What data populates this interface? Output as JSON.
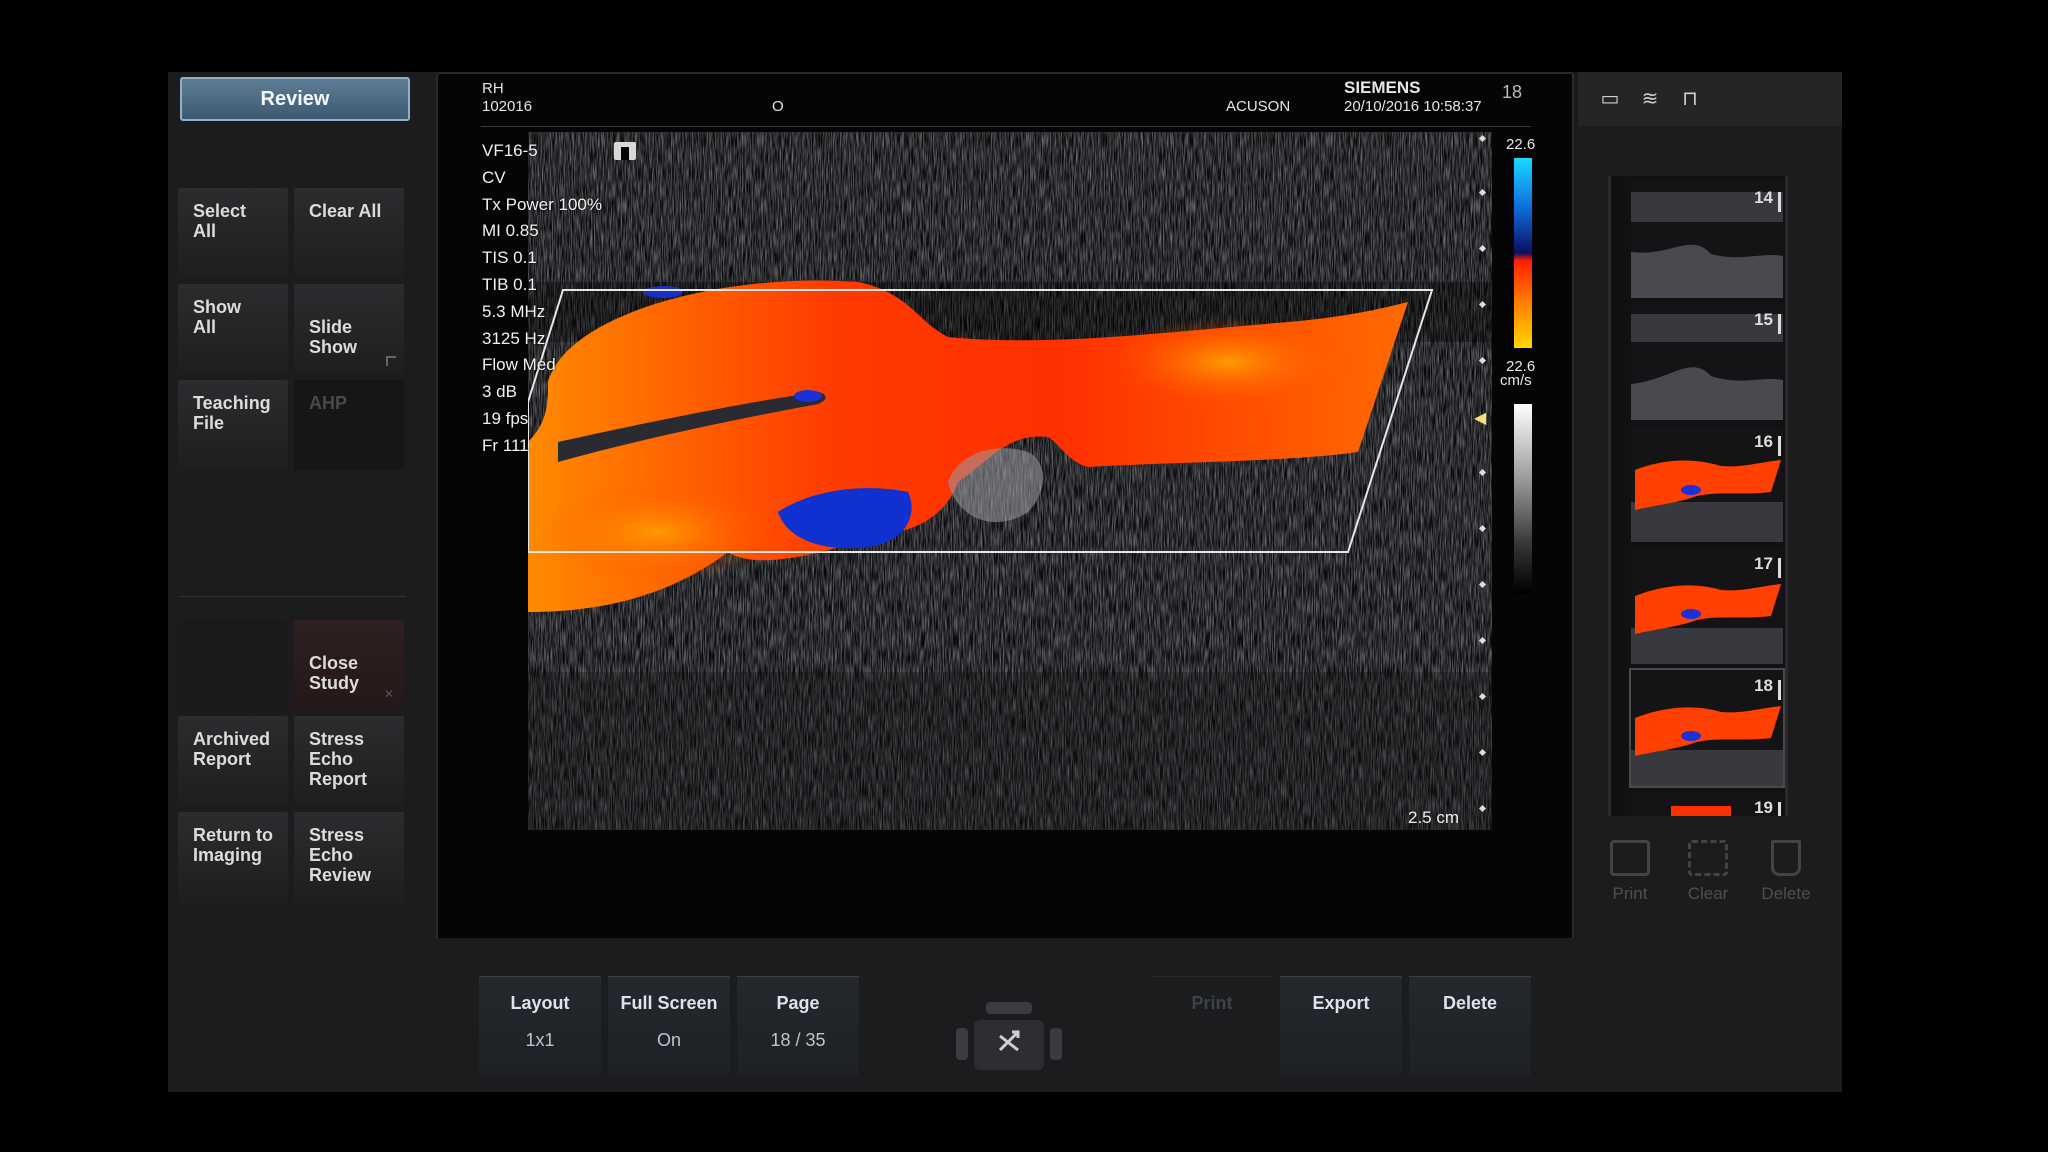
{
  "left_panel": {
    "review_tab": "Review",
    "buttons": {
      "select_all": "Select All",
      "clear_all": "Clear All",
      "show_all": "Show\nAll",
      "slide_show": "Slide\nShow",
      "teaching_file": "Teaching\nFile",
      "ahp": "AHP",
      "close_study": "Close\nStudy",
      "archived_report": "Archived\nReport",
      "stress_echo_report": "Stress\nEcho\nReport",
      "return_to_imaging": "Return to\nImaging",
      "stress_echo_review": "Stress\nEcho\nReview"
    }
  },
  "image_header": {
    "patient_line1": "RH",
    "patient_line2": "102016",
    "center_marker": "O",
    "system": "ACUSON",
    "brand": "SIEMENS",
    "datetime": "20/10/2016 10:58:37",
    "frame_number": "18"
  },
  "params": [
    "VF16-5",
    "CV",
    "Tx Power 100%",
    "MI 0.85",
    "TIS 0.1",
    "TIB 0.1",
    "5.3 MHz",
    "3125 Hz",
    "Flow Med",
    "3 dB",
    "19 fps",
    "Fr 111"
  ],
  "color_scale": {
    "top_value": "22.6",
    "bottom_value": "22.6",
    "unit": "cm/s"
  },
  "depth_label": "2.5 cm",
  "thumbnails": [
    {
      "num": "14",
      "type": "gray"
    },
    {
      "num": "15",
      "type": "gray"
    },
    {
      "num": "16",
      "type": "color"
    },
    {
      "num": "17",
      "type": "color"
    },
    {
      "num": "18",
      "type": "color"
    },
    {
      "num": "19",
      "type": "color"
    }
  ],
  "right_tools": {
    "print": "Print",
    "clear": "Clear",
    "delete": "Delete"
  },
  "bottom_bar": {
    "layout_label": "Layout",
    "layout_value": "1x1",
    "fullscreen_label": "Full Screen",
    "fullscreen_value": "On",
    "page_label": "Page",
    "page_value": "18 / 35",
    "print_label": "Print",
    "export_label": "Export",
    "delete_label": "Delete"
  },
  "colors": {
    "review_tab": "#4f7088",
    "flow_red": "#ff3a00",
    "flow_orange": "#ff8a00",
    "flow_blue": "#1030d0"
  }
}
